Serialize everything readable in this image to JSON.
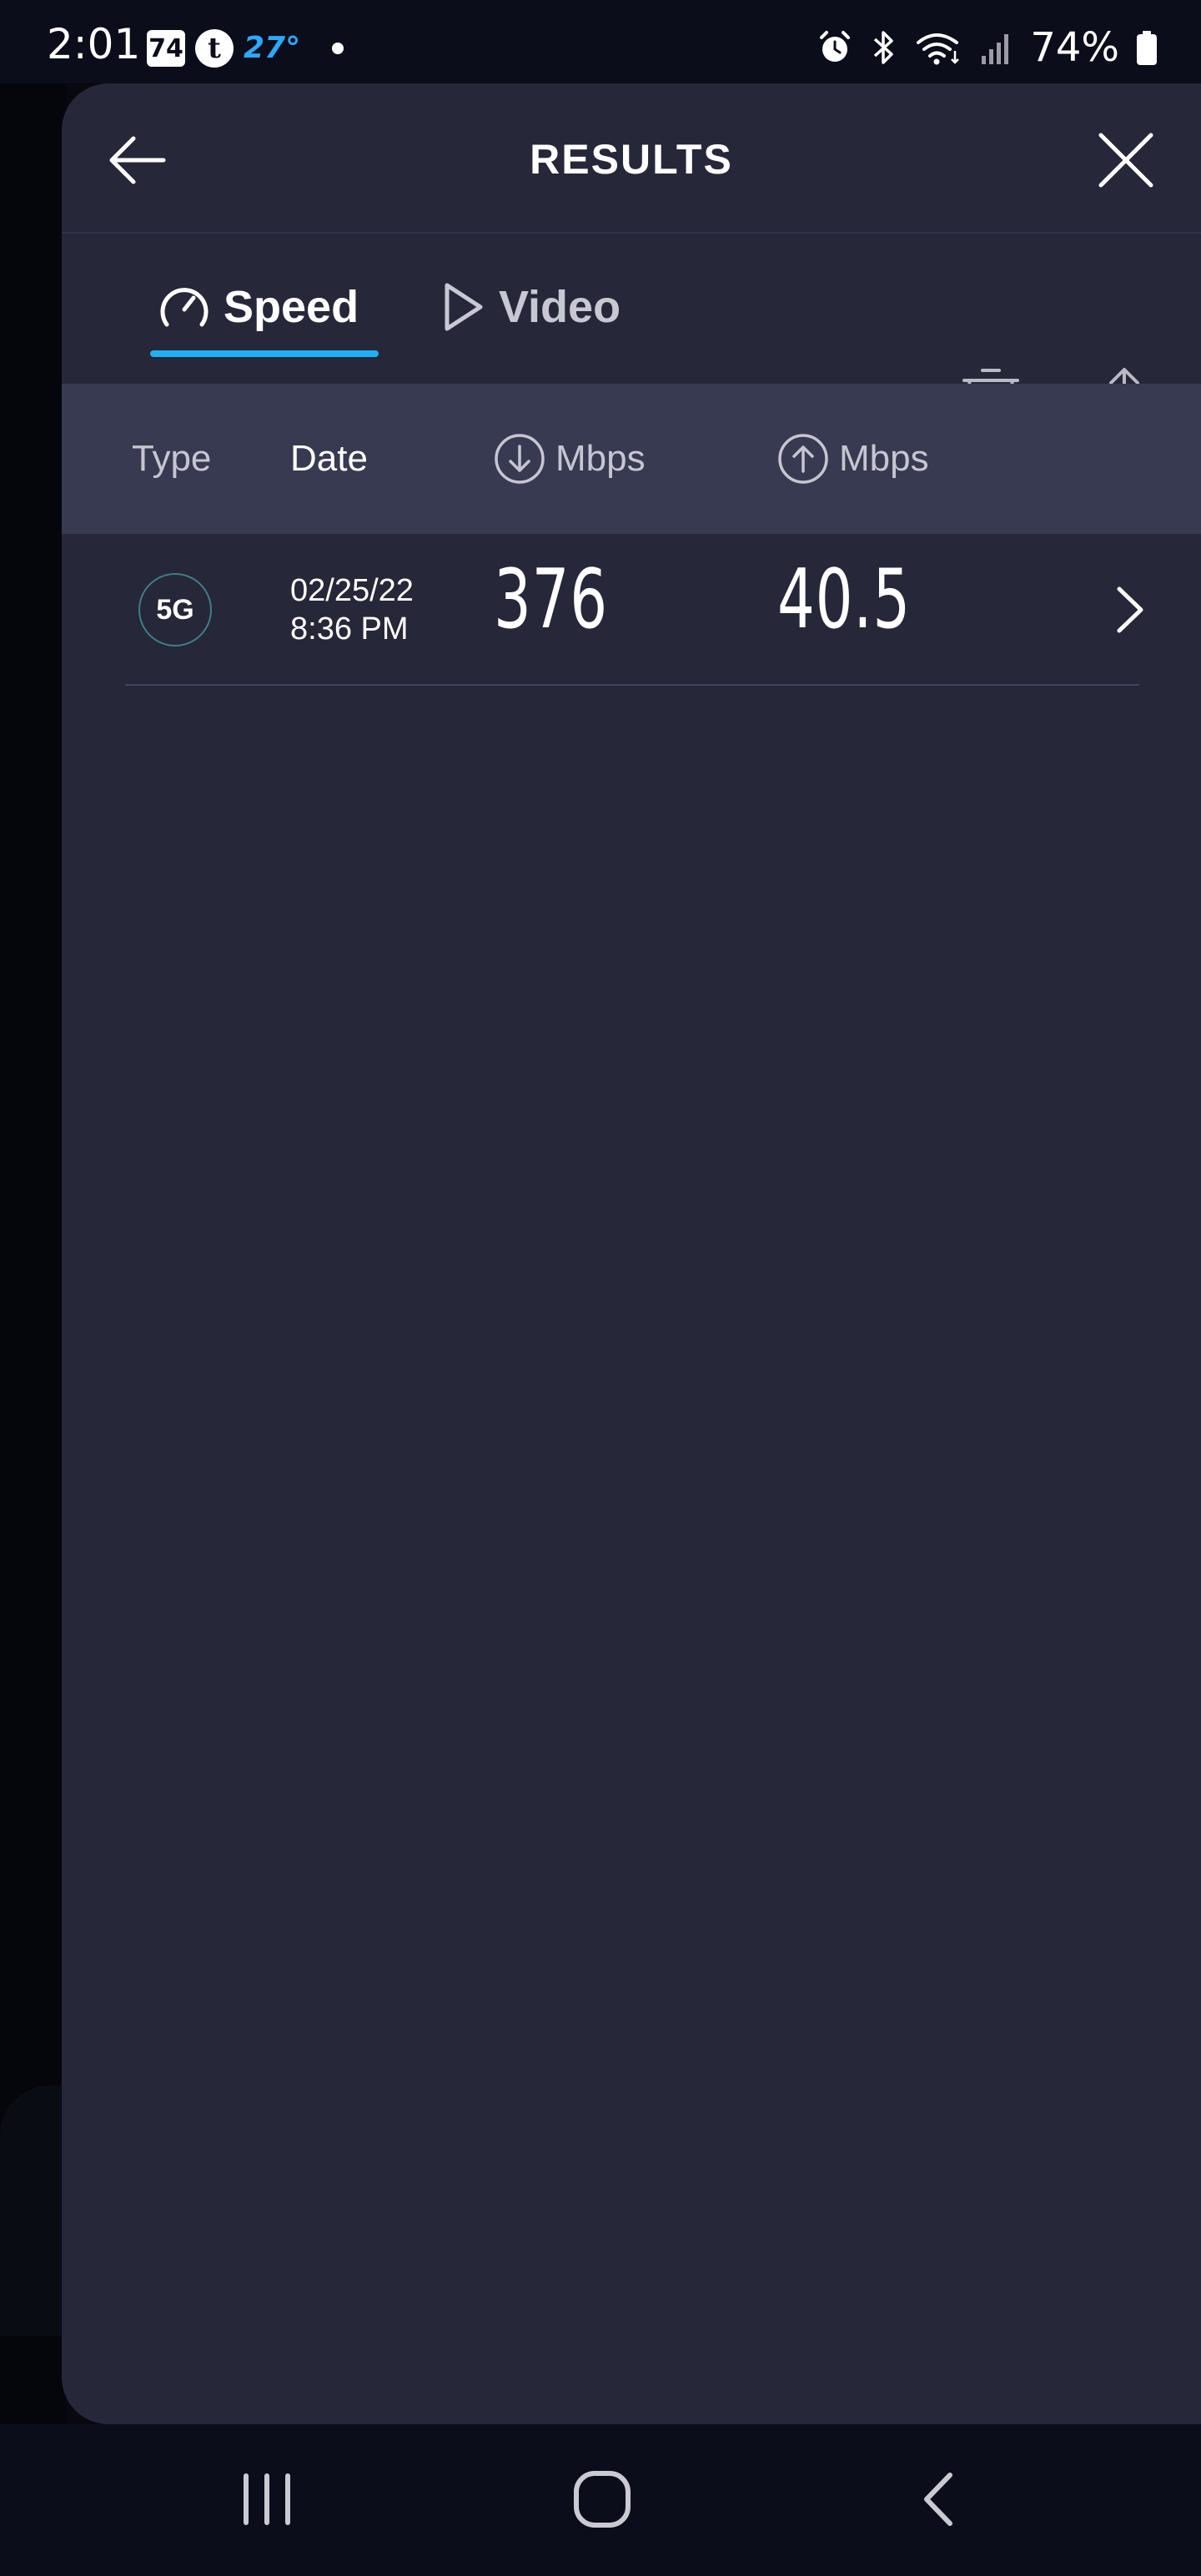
{
  "status_bar": {
    "time": "2:01",
    "calendar_badge": "74",
    "temperature": "27°",
    "battery": "74%"
  },
  "header": {
    "title": "RESULTS"
  },
  "tabs": [
    {
      "label": "Speed",
      "active": true
    },
    {
      "label": "Video",
      "active": false
    }
  ],
  "table": {
    "columns": {
      "type": "Type",
      "date": "Date",
      "download": "Mbps",
      "upload": "Mbps"
    },
    "rows": [
      {
        "type": "5G",
        "date": "02/25/22",
        "time": "8:36 PM",
        "download": "376",
        "upload": "40.5"
      }
    ]
  },
  "colors": {
    "panel_bg": "#262739",
    "header_row_bg": "#383a51",
    "accent": "#1fb0f5",
    "status_temp": "#2da8ff"
  },
  "icons": {
    "back": "arrow-left-icon",
    "close": "close-icon",
    "speed_tab": "speedometer-icon",
    "video_tab": "play-icon",
    "delete": "trash-icon",
    "share": "share-icon",
    "download": "arrow-down-circle-icon",
    "upload": "arrow-up-circle-icon",
    "row_open": "chevron-right-icon"
  }
}
